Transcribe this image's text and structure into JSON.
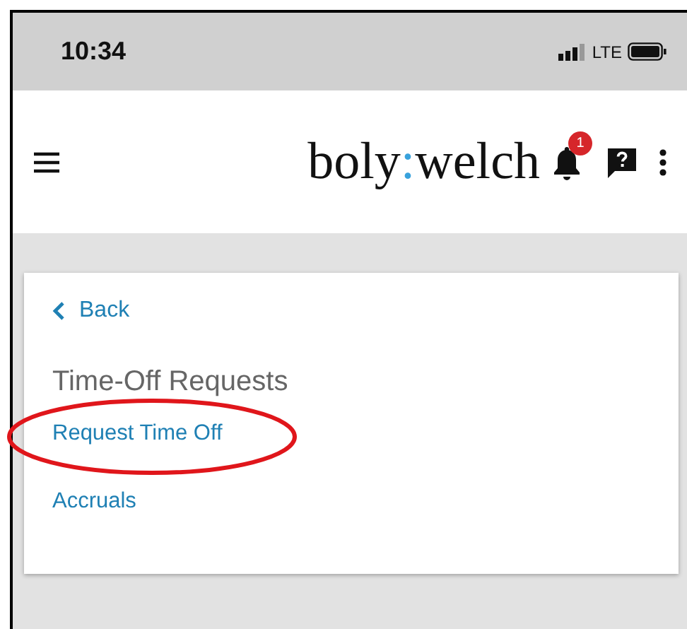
{
  "status_bar": {
    "time": "10:34",
    "network": "LTE"
  },
  "header": {
    "logo": {
      "left": "boly",
      "separator": ":",
      "right": "welch"
    },
    "notification_count": "1"
  },
  "card": {
    "back": "Back",
    "title": "Time-Off Requests",
    "links": [
      {
        "label": "Request Time Off",
        "circled": true
      },
      {
        "label": "Accruals",
        "circled": false
      }
    ]
  }
}
